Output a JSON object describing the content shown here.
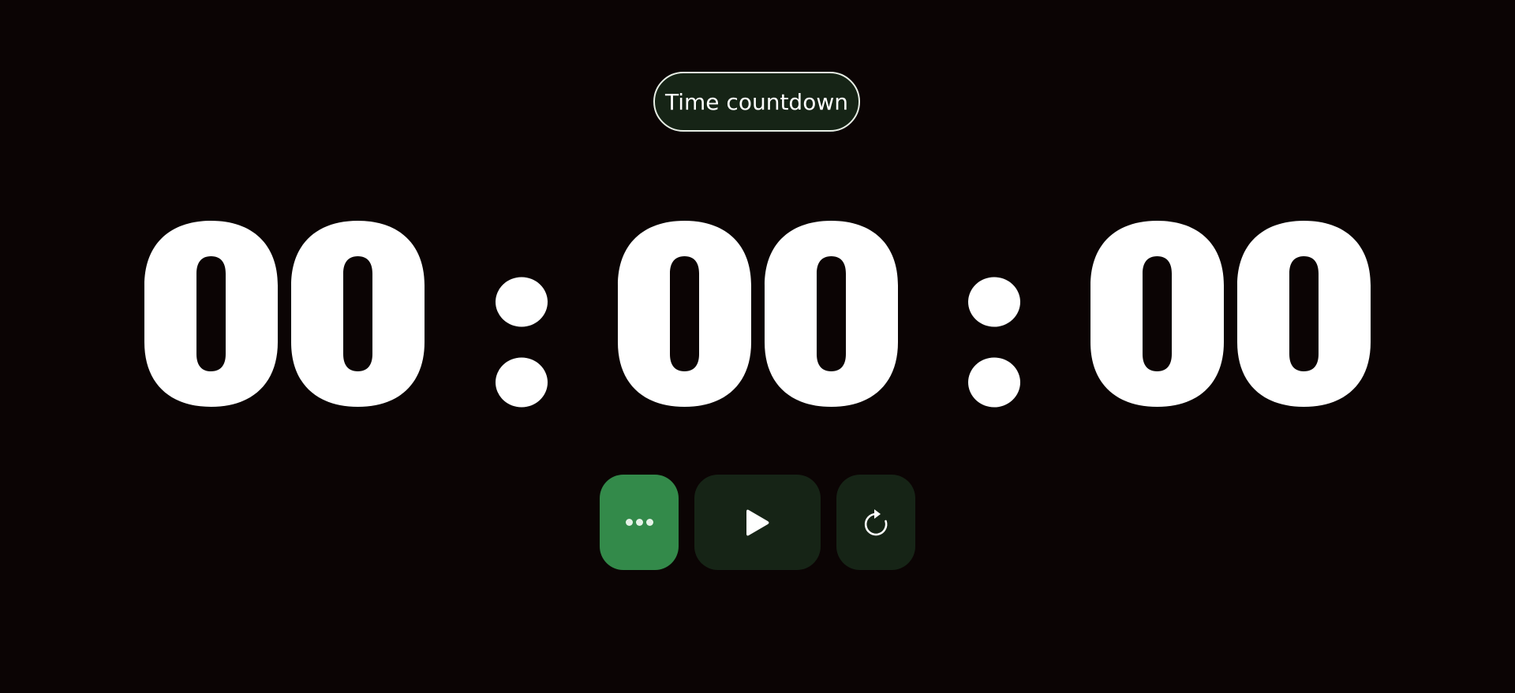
{
  "app": {
    "title": "Time countdown"
  },
  "timer": {
    "hours": "00",
    "minutes": "00",
    "seconds": "00",
    "separator": ":"
  },
  "controls": {
    "menu_icon": "more-horizontal-icon",
    "play_icon": "play-icon",
    "reset_icon": "reset-icon"
  },
  "colors": {
    "background": "#0b0404",
    "accent": "#338a4a",
    "button_dark": "#162416",
    "text": "#ffffff"
  }
}
